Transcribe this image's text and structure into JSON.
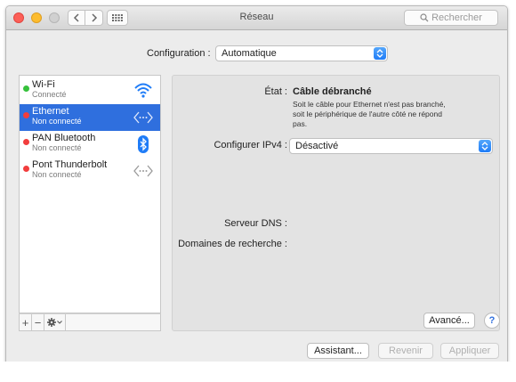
{
  "window": {
    "title": "Réseau",
    "search_placeholder": "Rechercher"
  },
  "configuration": {
    "label": "Configuration :",
    "value": "Automatique"
  },
  "services": [
    {
      "name": "Wi-Fi",
      "status": "Connecté",
      "dot_color": "#36c13b",
      "icon": "wifi-icon",
      "selected": false
    },
    {
      "name": "Ethernet",
      "status": "Non connecté",
      "dot_color": "#f23d3d",
      "icon": "ethernet-icon",
      "selected": true
    },
    {
      "name": "PAN Bluetooth",
      "status": "Non connecté",
      "dot_color": "#f23d3d",
      "icon": "bluetooth-icon",
      "selected": false
    },
    {
      "name": "Pont Thunderbolt",
      "status": "Non connecté",
      "dot_color": "#f23d3d",
      "icon": "thunderbolt-bridge-icon",
      "selected": false
    }
  ],
  "sidebar_toolbar": {
    "add": "+",
    "remove": "−"
  },
  "detail": {
    "state_label": "État :",
    "state_value": "Câble débranché",
    "state_description": "Soit le câble pour Ethernet n'est pas branché, soit le périphérique de l'autre côté ne répond pas.",
    "ipv4_label": "Configurer IPv4 :",
    "ipv4_value": "Désactivé",
    "dns_label": "Serveur DNS :",
    "search_domains_label": "Domaines de recherche :",
    "advanced_button": "Avancé...",
    "help_button": "?"
  },
  "footer": {
    "assistant": "Assistant...",
    "revert": "Revenir",
    "apply": "Appliquer"
  },
  "colors": {
    "selection": "#2f6fde",
    "accent": "#1f7cf7",
    "connected": "#36c13b",
    "disconnected": "#f23d3d"
  }
}
